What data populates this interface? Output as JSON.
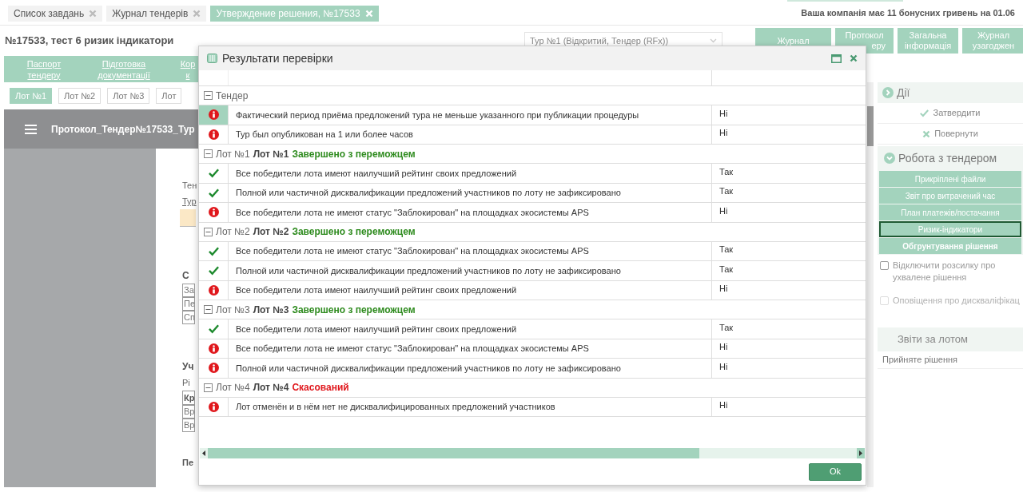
{
  "tabs": [
    {
      "label": "Список завдань",
      "selected": false
    },
    {
      "label": "Журнал тендерів",
      "selected": false
    },
    {
      "label": "Утверждение решения, №17533",
      "selected": true
    }
  ],
  "bonus_notice": "Ваша компанія має 11 бонусних гривень на 01.06",
  "tender_title": "№17533, тест 6 ризик індикатори",
  "tour_select": {
    "value": "Тур №1 (Відкритий, Тендер (RFx))"
  },
  "header_buttons": [
    {
      "lines": [
        "Журнал"
      ]
    },
    {
      "lines": [
        "Протокол",
        "еру"
      ]
    },
    {
      "lines": [
        "Загальна",
        "інформація"
      ]
    },
    {
      "lines": [
        "Журнал",
        "узагоджен"
      ]
    }
  ],
  "steps": [
    {
      "lines": [
        "Паспорт",
        "тендеру"
      ]
    },
    {
      "lines": [
        "Підготовка",
        "документації"
      ]
    },
    {
      "lines": [
        "Кор",
        "к"
      ]
    }
  ],
  "lots": [
    {
      "label": "Лот №1",
      "selected": true
    },
    {
      "label": "Лот №2",
      "selected": false
    },
    {
      "label": "Лот №3",
      "selected": false
    },
    {
      "label": "Лот",
      "selected": false
    }
  ],
  "document": {
    "title": "Протокол_Тендер№17533_Тур",
    "fragments": [
      {
        "text": "Тен",
        "kind": "plain"
      },
      {
        "text": "Тур",
        "kind": "link"
      },
      {
        "kind": "highlight"
      },
      {
        "text": "С",
        "kind": "heading"
      },
      {
        "text": "За",
        "kind": "cell"
      },
      {
        "text": "Пе",
        "kind": "cell"
      },
      {
        "text": "Сп",
        "kind": "cell"
      },
      {
        "text": "Уч",
        "kind": "heading"
      },
      {
        "text": "Рі",
        "kind": "plain"
      },
      {
        "text": "Кр",
        "kind": "cellbold"
      },
      {
        "text": "Вр",
        "kind": "cell"
      },
      {
        "text": "Вр",
        "kind": "cell"
      },
      {
        "text": "Пе",
        "kind": "footer"
      }
    ]
  },
  "actions": {
    "title": "Дії",
    "items": [
      {
        "label": "Затвердити",
        "kind": "approve"
      },
      {
        "label": "Повернути",
        "kind": "reject"
      }
    ]
  },
  "tender_work": {
    "title": "Робота з тендером",
    "buttons": [
      {
        "label": "Прикріплені файли",
        "selected": false,
        "bold": false
      },
      {
        "label": "Звіт про витрачений час",
        "selected": false,
        "bold": false
      },
      {
        "label": "План платежів/постачання",
        "selected": false,
        "bold": false
      },
      {
        "label": "Ризик-індикатори",
        "selected": true,
        "bold": false
      },
      {
        "label": "Обгрунтування рішення",
        "selected": false,
        "bold": true
      }
    ],
    "checkboxes": [
      {
        "label": "Відключити розсилку про ухвалене рішення",
        "checked": false,
        "disabled": false
      },
      {
        "label": "Оповіщення про дискваліфікац",
        "checked": false,
        "disabled": true
      }
    ]
  },
  "lot_reports": {
    "title": "Звіти за лотом",
    "items": [
      "Прийняте рішення"
    ]
  },
  "dialog": {
    "title": "Результати перевірки",
    "groups": [
      {
        "prefix": "Тендер",
        "expanded": true,
        "rows": [
          {
            "kind": "fail",
            "text": "Фактический период приёма предложений тура не меньше указанного при публикации процедуры",
            "value": "Ні",
            "selected": true
          },
          {
            "kind": "fail",
            "text": "Тур был опубликован на 1 или более часов",
            "value": "Ні",
            "selected": false
          }
        ]
      },
      {
        "prefix": "Лот №1",
        "name": "Лот №1",
        "status": "Завершено з переможцем",
        "color": "#2e8b1e",
        "expanded": true,
        "rows": [
          {
            "kind": "pass",
            "text": "Все победители лота имеют наилучший рейтинг своих предложений",
            "value": "Так",
            "selected": false
          },
          {
            "kind": "pass",
            "text": "Полной или частичной дисквалификации предложений участников по лоту не зафиксировано",
            "value": "Так",
            "selected": false
          },
          {
            "kind": "fail",
            "text": "Все победители лота не имеют статус \"Заблокирован\" на площадках экосистемы APS",
            "value": "Ні",
            "selected": false
          }
        ]
      },
      {
        "prefix": "Лот №2",
        "name": "Лот №2",
        "status": "Завершено з переможцем",
        "color": "#2e8b1e",
        "expanded": true,
        "rows": [
          {
            "kind": "pass",
            "text": "Все победители лота не имеют статус \"Заблокирован\" на площадках экосистемы APS",
            "value": "Так",
            "selected": false
          },
          {
            "kind": "pass",
            "text": "Полной или частичной дисквалификации предложений участников по лоту не зафиксировано",
            "value": "Так",
            "selected": false
          },
          {
            "kind": "fail",
            "text": "Все победители лота имеют наилучший рейтинг своих предложений",
            "value": "Ні",
            "selected": false
          }
        ]
      },
      {
        "prefix": "Лот №3",
        "name": "Лот №3",
        "status": "Завершено з переможцем",
        "color": "#2e8b1e",
        "expanded": true,
        "rows": [
          {
            "kind": "pass",
            "text": "Все победители лота имеют наилучший рейтинг своих предложений",
            "value": "Так",
            "selected": false
          },
          {
            "kind": "fail",
            "text": "Все победители лота не имеют статус \"Заблокирован\" на площадках экосистемы APS",
            "value": "Ні",
            "selected": false
          },
          {
            "kind": "fail",
            "text": "Полной или частичной дисквалификации предложений участников по лоту не зафиксировано",
            "value": "Ні",
            "selected": false
          }
        ]
      },
      {
        "prefix": "Лот №4",
        "name": "Лот №4",
        "status": "Скасований",
        "color": "#e0171c",
        "expanded": true,
        "rows": [
          {
            "kind": "fail",
            "text": "Лот отменён и в нём нет не дисквалифицированных предложений участников",
            "value": "Ні",
            "selected": false
          }
        ]
      }
    ],
    "ok_button": "Ok"
  }
}
